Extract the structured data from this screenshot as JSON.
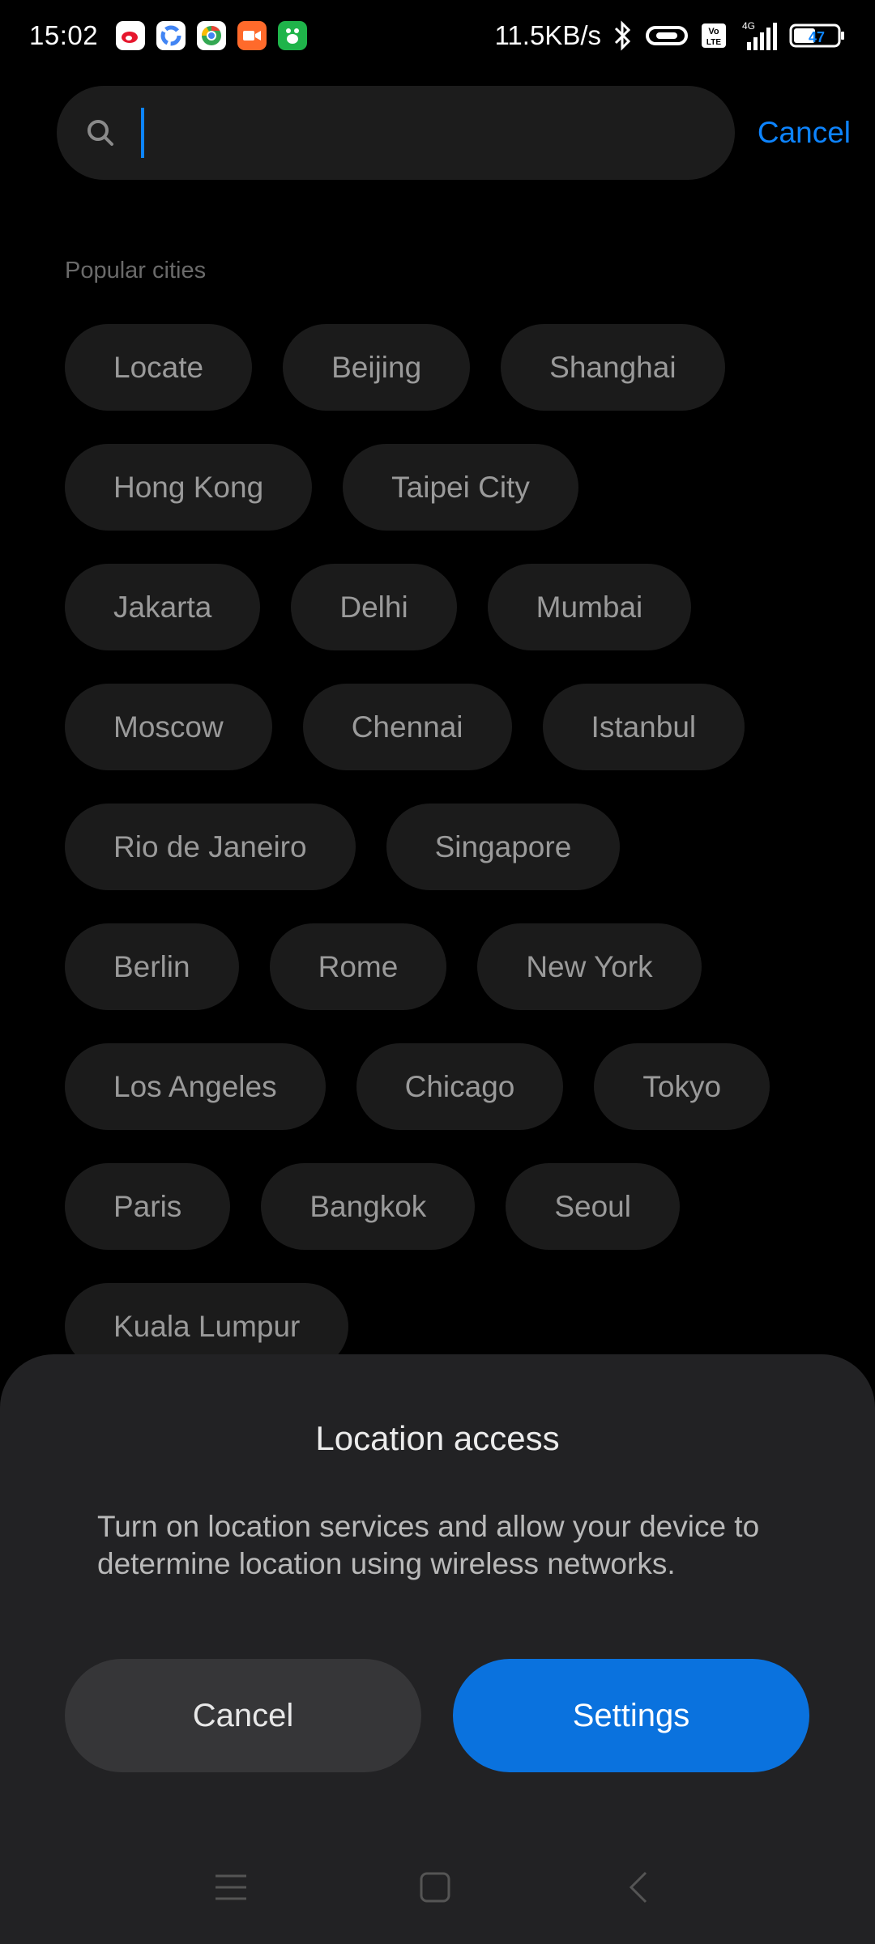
{
  "status_bar": {
    "time": "15:02",
    "speed": "11.5KB/s",
    "network_label": "4G",
    "volte_label": "Vo LTE",
    "battery": "47",
    "app_icons": [
      "weibo-app-icon",
      "google-app-icon",
      "chrome-app-icon",
      "video-app-icon",
      "paw-app-icon"
    ]
  },
  "search": {
    "placeholder": "",
    "value": "",
    "cancel_label": "Cancel"
  },
  "popular": {
    "title": "Popular cities",
    "rows": [
      [
        "Locate",
        "Beijing",
        "Shanghai"
      ],
      [
        "Hong Kong",
        "Taipei City"
      ],
      [
        "Jakarta",
        "Delhi",
        "Mumbai"
      ],
      [
        "Moscow",
        "Chennai",
        "Istanbul"
      ],
      [
        "Rio de Janeiro",
        "Singapore"
      ],
      [
        "Berlin",
        "Rome",
        "New York"
      ],
      [
        "Los Angeles",
        "Chicago",
        "Tokyo"
      ],
      [
        "Paris",
        "Bangkok",
        "Seoul"
      ],
      [
        "Kuala Lumpur"
      ]
    ]
  },
  "dialog": {
    "title": "Location access",
    "message": "Turn on location services and allow your device to determine location using wireless networks.",
    "cancel_label": "Cancel",
    "settings_label": "Settings"
  },
  "colors": {
    "accent": "#0d84ff",
    "settings_button": "#0a72de"
  }
}
